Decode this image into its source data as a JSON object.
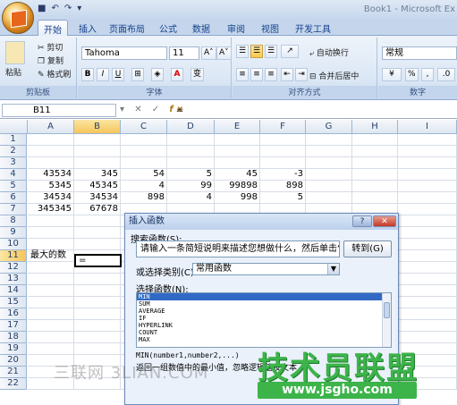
{
  "window": {
    "title": "Book1 - Microsoft Ex"
  },
  "qat": {
    "save": "■",
    "undo": "↶",
    "redo": "↷",
    "more": "▾"
  },
  "tabs": [
    "开始",
    "插入",
    "页面布局",
    "公式",
    "数据",
    "审阅",
    "视图",
    "开发工具"
  ],
  "ribbon": {
    "clipboard": {
      "paste": "粘贴",
      "cut": "剪切",
      "copy": "复制",
      "painter": "格式刷",
      "label": "剪贴板"
    },
    "font": {
      "name": "Tahoma",
      "size": "11",
      "grow": "A˄",
      "shrink": "A˅",
      "bold": "B",
      "italic": "I",
      "underline": "U",
      "border": "⊞",
      "fill": "◈",
      "color": "A",
      "phonetic": "变",
      "label": "字体"
    },
    "align": {
      "wrap": "自动换行",
      "merge": "合并后居中",
      "label": "对齐方式"
    },
    "number": {
      "format": "常规",
      "percent": "%",
      "comma": ",",
      "label": "数字"
    }
  },
  "formula_bar": {
    "name_box": "B11",
    "cancel": "✕",
    "enter": "✓",
    "fx": "fx",
    "value": "="
  },
  "sheet": {
    "columns": [
      "A",
      "B",
      "C",
      "D",
      "E",
      "F",
      "G",
      "H",
      "I"
    ],
    "rows": [
      "1",
      "2",
      "3",
      "4",
      "5",
      "6",
      "7",
      "8",
      "9",
      "10",
      "11",
      "12",
      "13",
      "14",
      "15",
      "16",
      "17",
      "18",
      "19",
      "20",
      "21",
      "22"
    ],
    "data": [
      {
        "row": 4,
        "values": [
          "43534",
          "345",
          "54",
          "5",
          "45",
          "-3"
        ]
      },
      {
        "row": 5,
        "values": [
          "5345",
          "45345",
          "4",
          "99",
          "99898",
          "898"
        ]
      },
      {
        "row": 6,
        "values": [
          "34534",
          "34534",
          "898",
          "4",
          "998",
          "5"
        ]
      },
      {
        "row": 7,
        "values": [
          "345345",
          "67678",
          "",
          "",
          "",
          ""
        ]
      }
    ],
    "label_a11": "最大的数",
    "active_cell_value": "="
  },
  "dialog": {
    "title": "插入函数",
    "help": "?",
    "close": "✕",
    "search_label": "搜索函数(S):",
    "search_value": "请输入一条简短说明来描述您想做什么，然后单击“转到”",
    "go_button": "转到(G)",
    "category_label": "或选择类别(C):",
    "category_value": "常用函数",
    "function_label": "选择函数(N):",
    "functions": [
      "MIN",
      "SUM",
      "AVERAGE",
      "IF",
      "HYPERLINK",
      "COUNT",
      "MAX"
    ],
    "selected_function": "MIN",
    "signature": "MIN(number1,number2,...)",
    "description": "返回一组数值中的最小值，忽略逻辑值及文本"
  },
  "watermarks": {
    "left": "三联网 3LIAN.COM",
    "brand": "技术员联盟",
    "url": "www.jsgho.com"
  }
}
